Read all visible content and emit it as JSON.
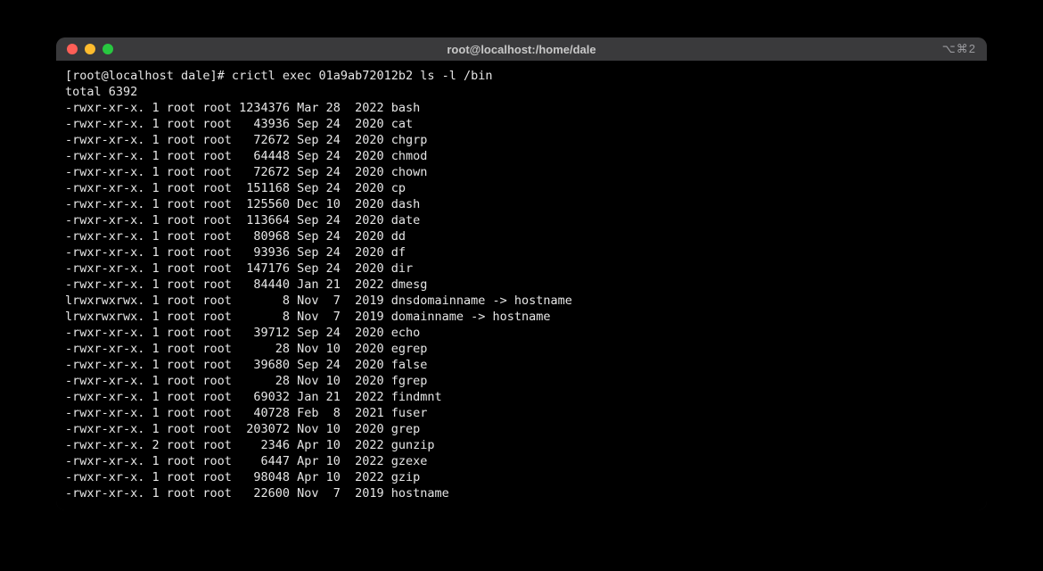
{
  "window": {
    "title": "root@localhost:/home/dale",
    "right_indicator": "⌥⌘2"
  },
  "prompt": {
    "text": "[root@localhost dale]# ",
    "command": "crictl exec 01a9ab72012b2 ls -l /bin"
  },
  "total_line": "total 6392",
  "entries": [
    {
      "perm": "-rwxr-xr-x.",
      "links": "1",
      "user": "root",
      "group": "root",
      "size": "1234376",
      "mon": "Mar",
      "day": "28",
      "yr": "2022",
      "name": "bash"
    },
    {
      "perm": "-rwxr-xr-x.",
      "links": "1",
      "user": "root",
      "group": "root",
      "size": "43936",
      "mon": "Sep",
      "day": "24",
      "yr": "2020",
      "name": "cat"
    },
    {
      "perm": "-rwxr-xr-x.",
      "links": "1",
      "user": "root",
      "group": "root",
      "size": "72672",
      "mon": "Sep",
      "day": "24",
      "yr": "2020",
      "name": "chgrp"
    },
    {
      "perm": "-rwxr-xr-x.",
      "links": "1",
      "user": "root",
      "group": "root",
      "size": "64448",
      "mon": "Sep",
      "day": "24",
      "yr": "2020",
      "name": "chmod"
    },
    {
      "perm": "-rwxr-xr-x.",
      "links": "1",
      "user": "root",
      "group": "root",
      "size": "72672",
      "mon": "Sep",
      "day": "24",
      "yr": "2020",
      "name": "chown"
    },
    {
      "perm": "-rwxr-xr-x.",
      "links": "1",
      "user": "root",
      "group": "root",
      "size": "151168",
      "mon": "Sep",
      "day": "24",
      "yr": "2020",
      "name": "cp"
    },
    {
      "perm": "-rwxr-xr-x.",
      "links": "1",
      "user": "root",
      "group": "root",
      "size": "125560",
      "mon": "Dec",
      "day": "10",
      "yr": "2020",
      "name": "dash"
    },
    {
      "perm": "-rwxr-xr-x.",
      "links": "1",
      "user": "root",
      "group": "root",
      "size": "113664",
      "mon": "Sep",
      "day": "24",
      "yr": "2020",
      "name": "date"
    },
    {
      "perm": "-rwxr-xr-x.",
      "links": "1",
      "user": "root",
      "group": "root",
      "size": "80968",
      "mon": "Sep",
      "day": "24",
      "yr": "2020",
      "name": "dd"
    },
    {
      "perm": "-rwxr-xr-x.",
      "links": "1",
      "user": "root",
      "group": "root",
      "size": "93936",
      "mon": "Sep",
      "day": "24",
      "yr": "2020",
      "name": "df"
    },
    {
      "perm": "-rwxr-xr-x.",
      "links": "1",
      "user": "root",
      "group": "root",
      "size": "147176",
      "mon": "Sep",
      "day": "24",
      "yr": "2020",
      "name": "dir"
    },
    {
      "perm": "-rwxr-xr-x.",
      "links": "1",
      "user": "root",
      "group": "root",
      "size": "84440",
      "mon": "Jan",
      "day": "21",
      "yr": "2022",
      "name": "dmesg"
    },
    {
      "perm": "lrwxrwxrwx.",
      "links": "1",
      "user": "root",
      "group": "root",
      "size": "8",
      "mon": "Nov",
      "day": "7",
      "yr": "2019",
      "name": "dnsdomainname -> hostname"
    },
    {
      "perm": "lrwxrwxrwx.",
      "links": "1",
      "user": "root",
      "group": "root",
      "size": "8",
      "mon": "Nov",
      "day": "7",
      "yr": "2019",
      "name": "domainname -> hostname"
    },
    {
      "perm": "-rwxr-xr-x.",
      "links": "1",
      "user": "root",
      "group": "root",
      "size": "39712",
      "mon": "Sep",
      "day": "24",
      "yr": "2020",
      "name": "echo"
    },
    {
      "perm": "-rwxr-xr-x.",
      "links": "1",
      "user": "root",
      "group": "root",
      "size": "28",
      "mon": "Nov",
      "day": "10",
      "yr": "2020",
      "name": "egrep"
    },
    {
      "perm": "-rwxr-xr-x.",
      "links": "1",
      "user": "root",
      "group": "root",
      "size": "39680",
      "mon": "Sep",
      "day": "24",
      "yr": "2020",
      "name": "false"
    },
    {
      "perm": "-rwxr-xr-x.",
      "links": "1",
      "user": "root",
      "group": "root",
      "size": "28",
      "mon": "Nov",
      "day": "10",
      "yr": "2020",
      "name": "fgrep"
    },
    {
      "perm": "-rwxr-xr-x.",
      "links": "1",
      "user": "root",
      "group": "root",
      "size": "69032",
      "mon": "Jan",
      "day": "21",
      "yr": "2022",
      "name": "findmnt"
    },
    {
      "perm": "-rwxr-xr-x.",
      "links": "1",
      "user": "root",
      "group": "root",
      "size": "40728",
      "mon": "Feb",
      "day": "8",
      "yr": "2021",
      "name": "fuser"
    },
    {
      "perm": "-rwxr-xr-x.",
      "links": "1",
      "user": "root",
      "group": "root",
      "size": "203072",
      "mon": "Nov",
      "day": "10",
      "yr": "2020",
      "name": "grep"
    },
    {
      "perm": "-rwxr-xr-x.",
      "links": "2",
      "user": "root",
      "group": "root",
      "size": "2346",
      "mon": "Apr",
      "day": "10",
      "yr": "2022",
      "name": "gunzip"
    },
    {
      "perm": "-rwxr-xr-x.",
      "links": "1",
      "user": "root",
      "group": "root",
      "size": "6447",
      "mon": "Apr",
      "day": "10",
      "yr": "2022",
      "name": "gzexe"
    },
    {
      "perm": "-rwxr-xr-x.",
      "links": "1",
      "user": "root",
      "group": "root",
      "size": "98048",
      "mon": "Apr",
      "day": "10",
      "yr": "2022",
      "name": "gzip"
    },
    {
      "perm": "-rwxr-xr-x.",
      "links": "1",
      "user": "root",
      "group": "root",
      "size": "22600",
      "mon": "Nov",
      "day": "7",
      "yr": "2019",
      "name": "hostname"
    }
  ]
}
